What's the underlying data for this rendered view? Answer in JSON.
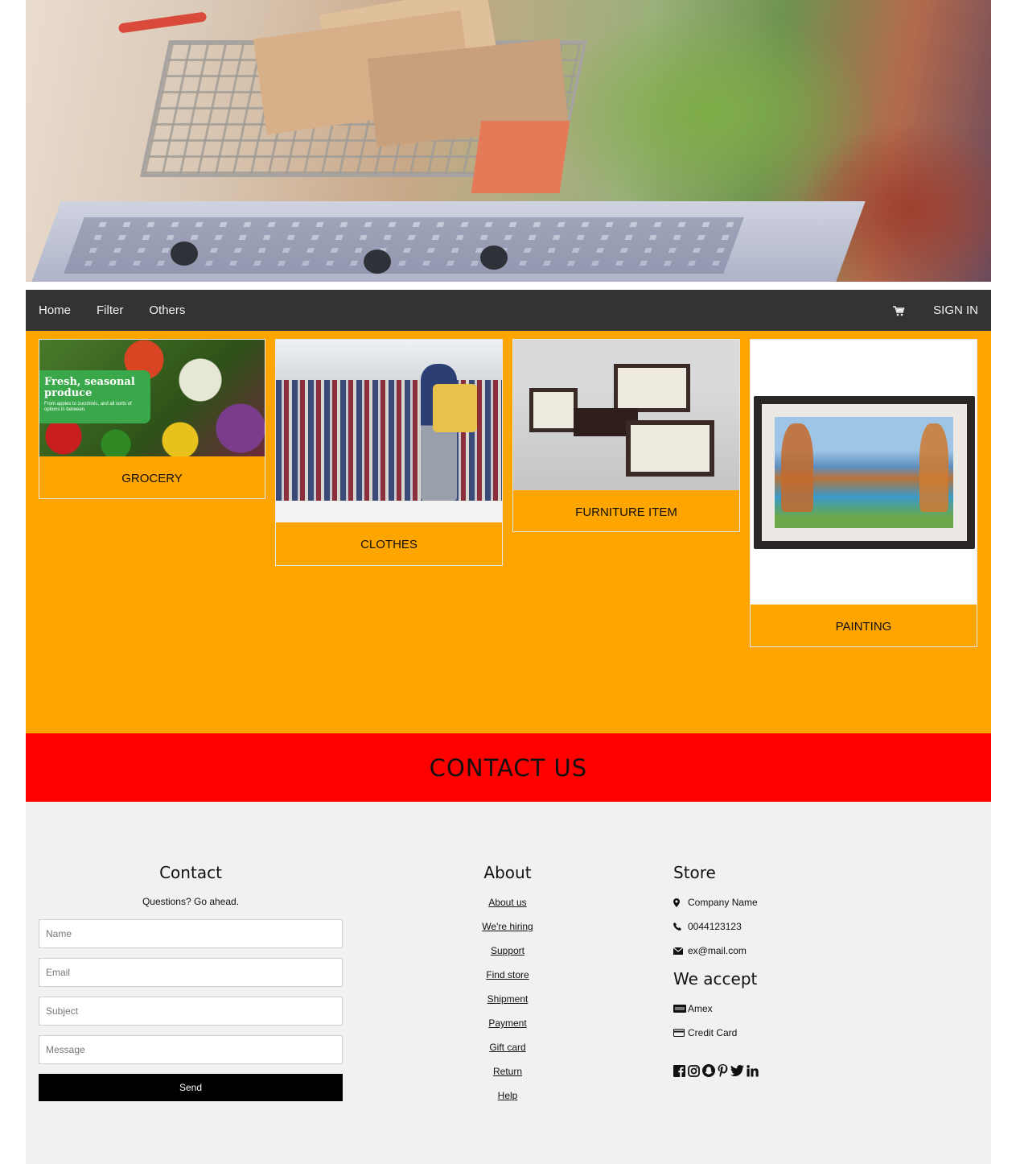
{
  "nav": {
    "home": "Home",
    "filter": "Filter",
    "others": "Others",
    "signin": "SIGN IN",
    "cart_icon": "shopping-cart-icon"
  },
  "hero": {
    "grocery_banner_title": "Fresh, seasonal produce",
    "grocery_banner_sub": "From apples to zucchinis, and all sorts of options in between."
  },
  "products": [
    {
      "label": "GROCERY"
    },
    {
      "label": "CLOTHES"
    },
    {
      "label": "FURNITURE ITEM"
    },
    {
      "label": "PAINTING"
    }
  ],
  "contact_banner": {
    "title": "CONTACT US"
  },
  "contact": {
    "title": "Contact",
    "subtitle": "Questions? Go ahead.",
    "name_placeholder": "Name",
    "email_placeholder": "Email",
    "subject_placeholder": "Subject",
    "message_placeholder": "Message",
    "send_label": "Send"
  },
  "about": {
    "title": "About",
    "links": [
      "About us",
      "We're hiring",
      "Support",
      "Find store",
      "Shipment",
      "Payment",
      "Gift card",
      "Return",
      "Help"
    ]
  },
  "store": {
    "title": "Store",
    "company": "Company Name",
    "phone": "0044123123",
    "email": "ex@mail.com",
    "accept_title": "We accept",
    "amex": "Amex",
    "credit_card": "Credit Card",
    "social_icons": [
      "facebook-icon",
      "instagram-icon",
      "snapchat-icon",
      "pinterest-icon",
      "twitter-icon",
      "linkedin-icon"
    ]
  },
  "colors": {
    "navbar": "#333333",
    "products_bg": "#ffa500",
    "contact_banner": "#ff0000",
    "footer_bg": "#f1f1f1",
    "send_button": "#000000"
  }
}
